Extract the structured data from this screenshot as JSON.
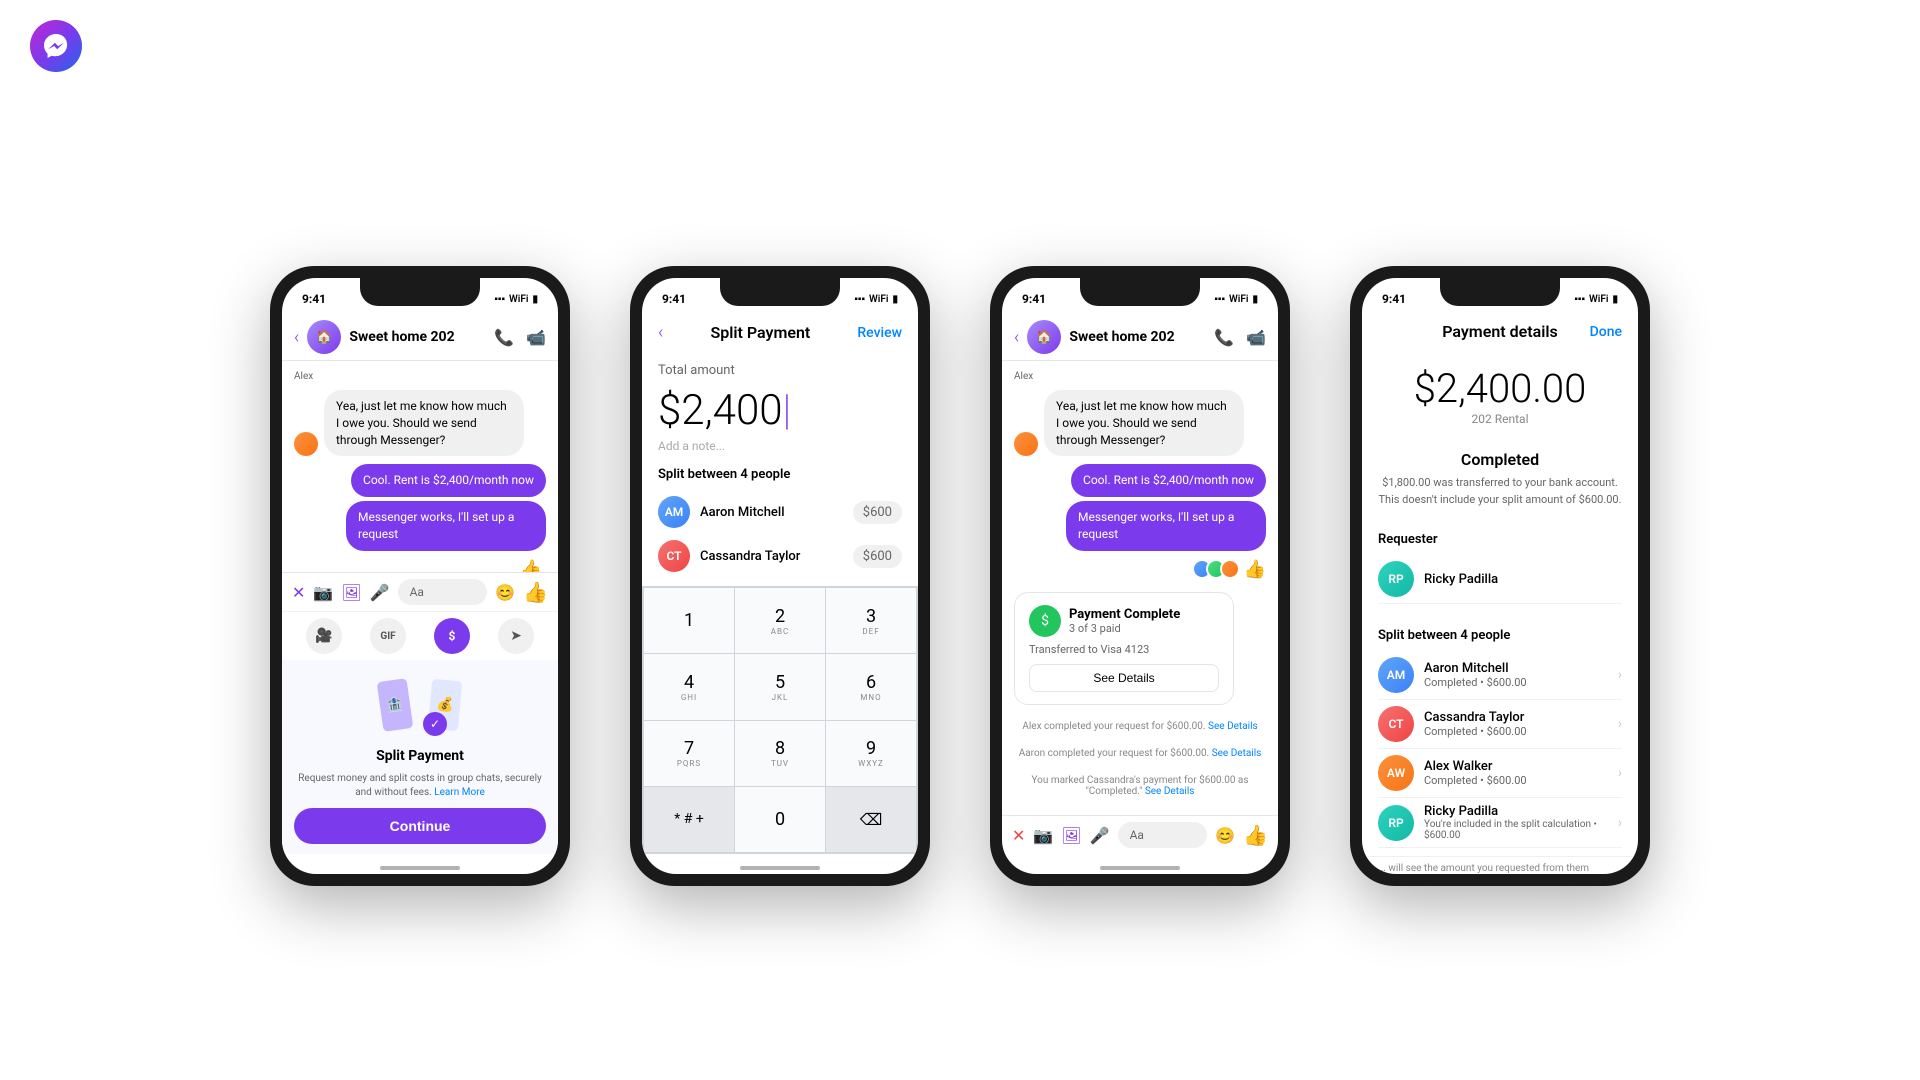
{
  "app": {
    "name": "Facebook Messenger",
    "logo_emoji": "💬"
  },
  "phone1": {
    "status_time": "9:41",
    "chat_title": "Sweet home 202",
    "messages": [
      {
        "sender": "Alex",
        "type": "incoming",
        "text": "Yea, just let me know how much I owe you. Should we send through Messenger?"
      },
      {
        "type": "outgoing",
        "text": "Cool. Rent is $2,400/month now"
      },
      {
        "type": "outgoing",
        "text": "Messenger works, I'll set up a request"
      },
      {
        "type": "emoji",
        "text": "👍"
      }
    ],
    "input_placeholder": "Aa",
    "promo_title": "Split Payment",
    "promo_desc": "Request money and split costs in group chats, securely and without fees.",
    "promo_learn_more": "Learn More",
    "continue_btn": "Continue"
  },
  "phone2": {
    "status_time": "9:41",
    "header_title": "Split Payment",
    "header_review": "Review",
    "total_label": "Total amount",
    "total_value": "$2,400",
    "cursor": "|",
    "add_note": "Add a note...",
    "split_label": "Split between 4 people",
    "people": [
      {
        "name": "Aaron Mitchell",
        "amount": "$600"
      },
      {
        "name": "Cassandra Taylor",
        "amount": "$600"
      }
    ],
    "numpad": [
      {
        "num": "1",
        "letters": ""
      },
      {
        "num": "2",
        "letters": "ABC"
      },
      {
        "num": "3",
        "letters": "DEF"
      },
      {
        "num": "4",
        "letters": "GHI"
      },
      {
        "num": "5",
        "letters": "JKL"
      },
      {
        "num": "6",
        "letters": "MNO"
      },
      {
        "num": "7",
        "letters": "PQRS"
      },
      {
        "num": "8",
        "letters": "TUV"
      },
      {
        "num": "9",
        "letters": "WXYZ"
      },
      {
        "num": "* # +",
        "letters": ""
      },
      {
        "num": "0",
        "letters": ""
      },
      {
        "num": "⌫",
        "letters": ""
      }
    ]
  },
  "phone3": {
    "status_time": "9:41",
    "chat_title": "Sweet home 202",
    "messages": [
      {
        "sender": "Alex",
        "type": "incoming",
        "text": "Yea, just let me know how much I owe you. Should we send through Messenger?"
      },
      {
        "type": "outgoing",
        "text": "Cool. Rent is $2,400/month now"
      },
      {
        "type": "outgoing",
        "text": "Messenger works, I'll set up a request"
      },
      {
        "type": "emoji",
        "text": "👍"
      }
    ],
    "payment_complete": {
      "count": "3 of 3 paid",
      "title": "Payment Complete",
      "visa": "Transferred to Visa 4123",
      "see_details": "See Details"
    },
    "system_messages": [
      {
        "text": "Alex completed your request for $600.00.",
        "link": "See Details"
      },
      {
        "text": "Aaron completed your request for $600.00.",
        "link": "See Details"
      },
      {
        "text": "You marked Cassandra's payment for $600.00 as \"Completed.\"",
        "link": "See Details"
      }
    ],
    "input_placeholder": "Aa"
  },
  "phone4": {
    "status_time": "9:41",
    "header_title": "Payment details",
    "done_label": "Done",
    "amount": "$2,400.00",
    "amount_sub": "202 Rental",
    "status_title": "Completed",
    "status_desc": "$1,800.00 was transferred to your bank account. This doesn't include your split amount of $600.00.",
    "requester_label": "Requester",
    "requester": {
      "name": "Ricky Padilla"
    },
    "split_label": "Split between 4 people",
    "people": [
      {
        "name": "Aaron Mitchell",
        "status": "Completed • $600.00"
      },
      {
        "name": "Cassandra Taylor",
        "status": "Completed • $600.00"
      },
      {
        "name": "Alex Walker",
        "status": "Completed • $600.00"
      },
      {
        "name": "Ricky Padilla",
        "status": "You're included in the split calculation • $600.00"
      }
    ]
  }
}
